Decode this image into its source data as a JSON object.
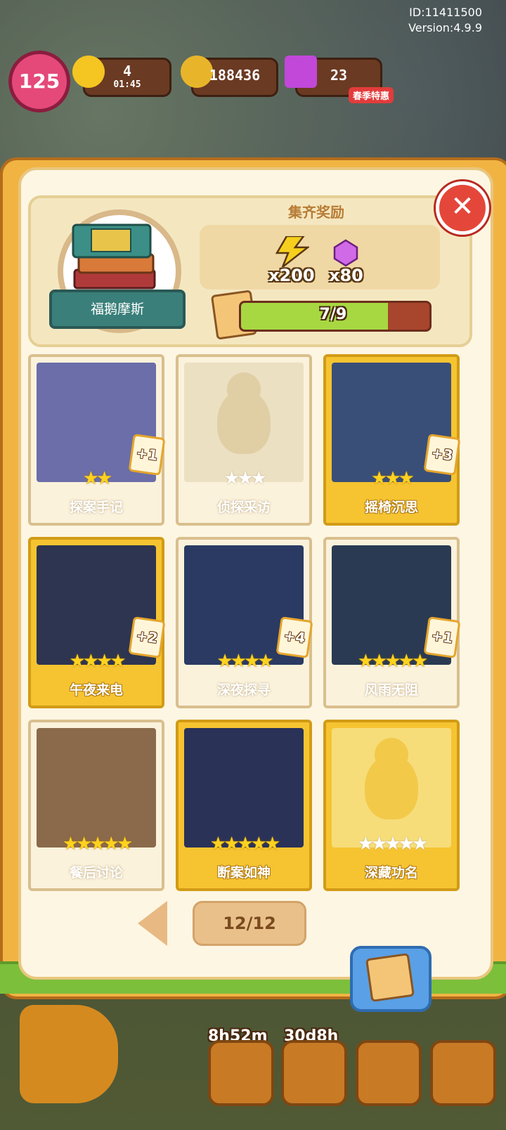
{
  "system": {
    "id_text": "ID:11411500",
    "version_text": "Version:4.9.9"
  },
  "hud": {
    "level": "125",
    "energy": "4",
    "energy_timer": "01:45",
    "coins": "188436",
    "gems": "23",
    "gem_promo": "春季特惠"
  },
  "collection": {
    "name": "福鹅摩斯",
    "reward_title": "集齐奖励",
    "reward_energy": "x200",
    "reward_gems": "x80",
    "progress_text": "7/9",
    "progress_fraction": 0.778,
    "close_icon": "close-icon"
  },
  "cards": [
    {
      "name": "探案手记",
      "stars_on": 2,
      "stars_total": 2,
      "collected": true,
      "gold": false,
      "badge": "+1"
    },
    {
      "name": "侦探采访",
      "stars_on": 0,
      "stars_total": 3,
      "collected": false,
      "gold": false,
      "badge": ""
    },
    {
      "name": "摇椅沉思",
      "stars_on": 3,
      "stars_total": 3,
      "collected": true,
      "gold": true,
      "badge": "+3"
    },
    {
      "name": "午夜来电",
      "stars_on": 4,
      "stars_total": 4,
      "collected": true,
      "gold": true,
      "badge": "+2"
    },
    {
      "name": "深夜探寻",
      "stars_on": 4,
      "stars_total": 4,
      "collected": true,
      "gold": false,
      "badge": "+4"
    },
    {
      "name": "风雨无阻",
      "stars_on": 5,
      "stars_total": 5,
      "collected": true,
      "gold": false,
      "badge": "+1"
    },
    {
      "name": "餐后讨论",
      "stars_on": 5,
      "stars_total": 5,
      "collected": true,
      "gold": false,
      "badge": ""
    },
    {
      "name": "断案如神",
      "stars_on": 5,
      "stars_total": 5,
      "collected": true,
      "gold": true,
      "badge": ""
    },
    {
      "name": "深藏功名",
      "stars_on": 0,
      "stars_total": 5,
      "collected": false,
      "gold": true,
      "badge": ""
    }
  ],
  "pager": {
    "text": "12/12"
  },
  "bottom": {
    "timer1": "8h52m",
    "timer2": "30d8h"
  },
  "colors": {
    "gold": "#f6c431",
    "accent_red": "#e4473a",
    "progress_green": "#a7d842"
  }
}
